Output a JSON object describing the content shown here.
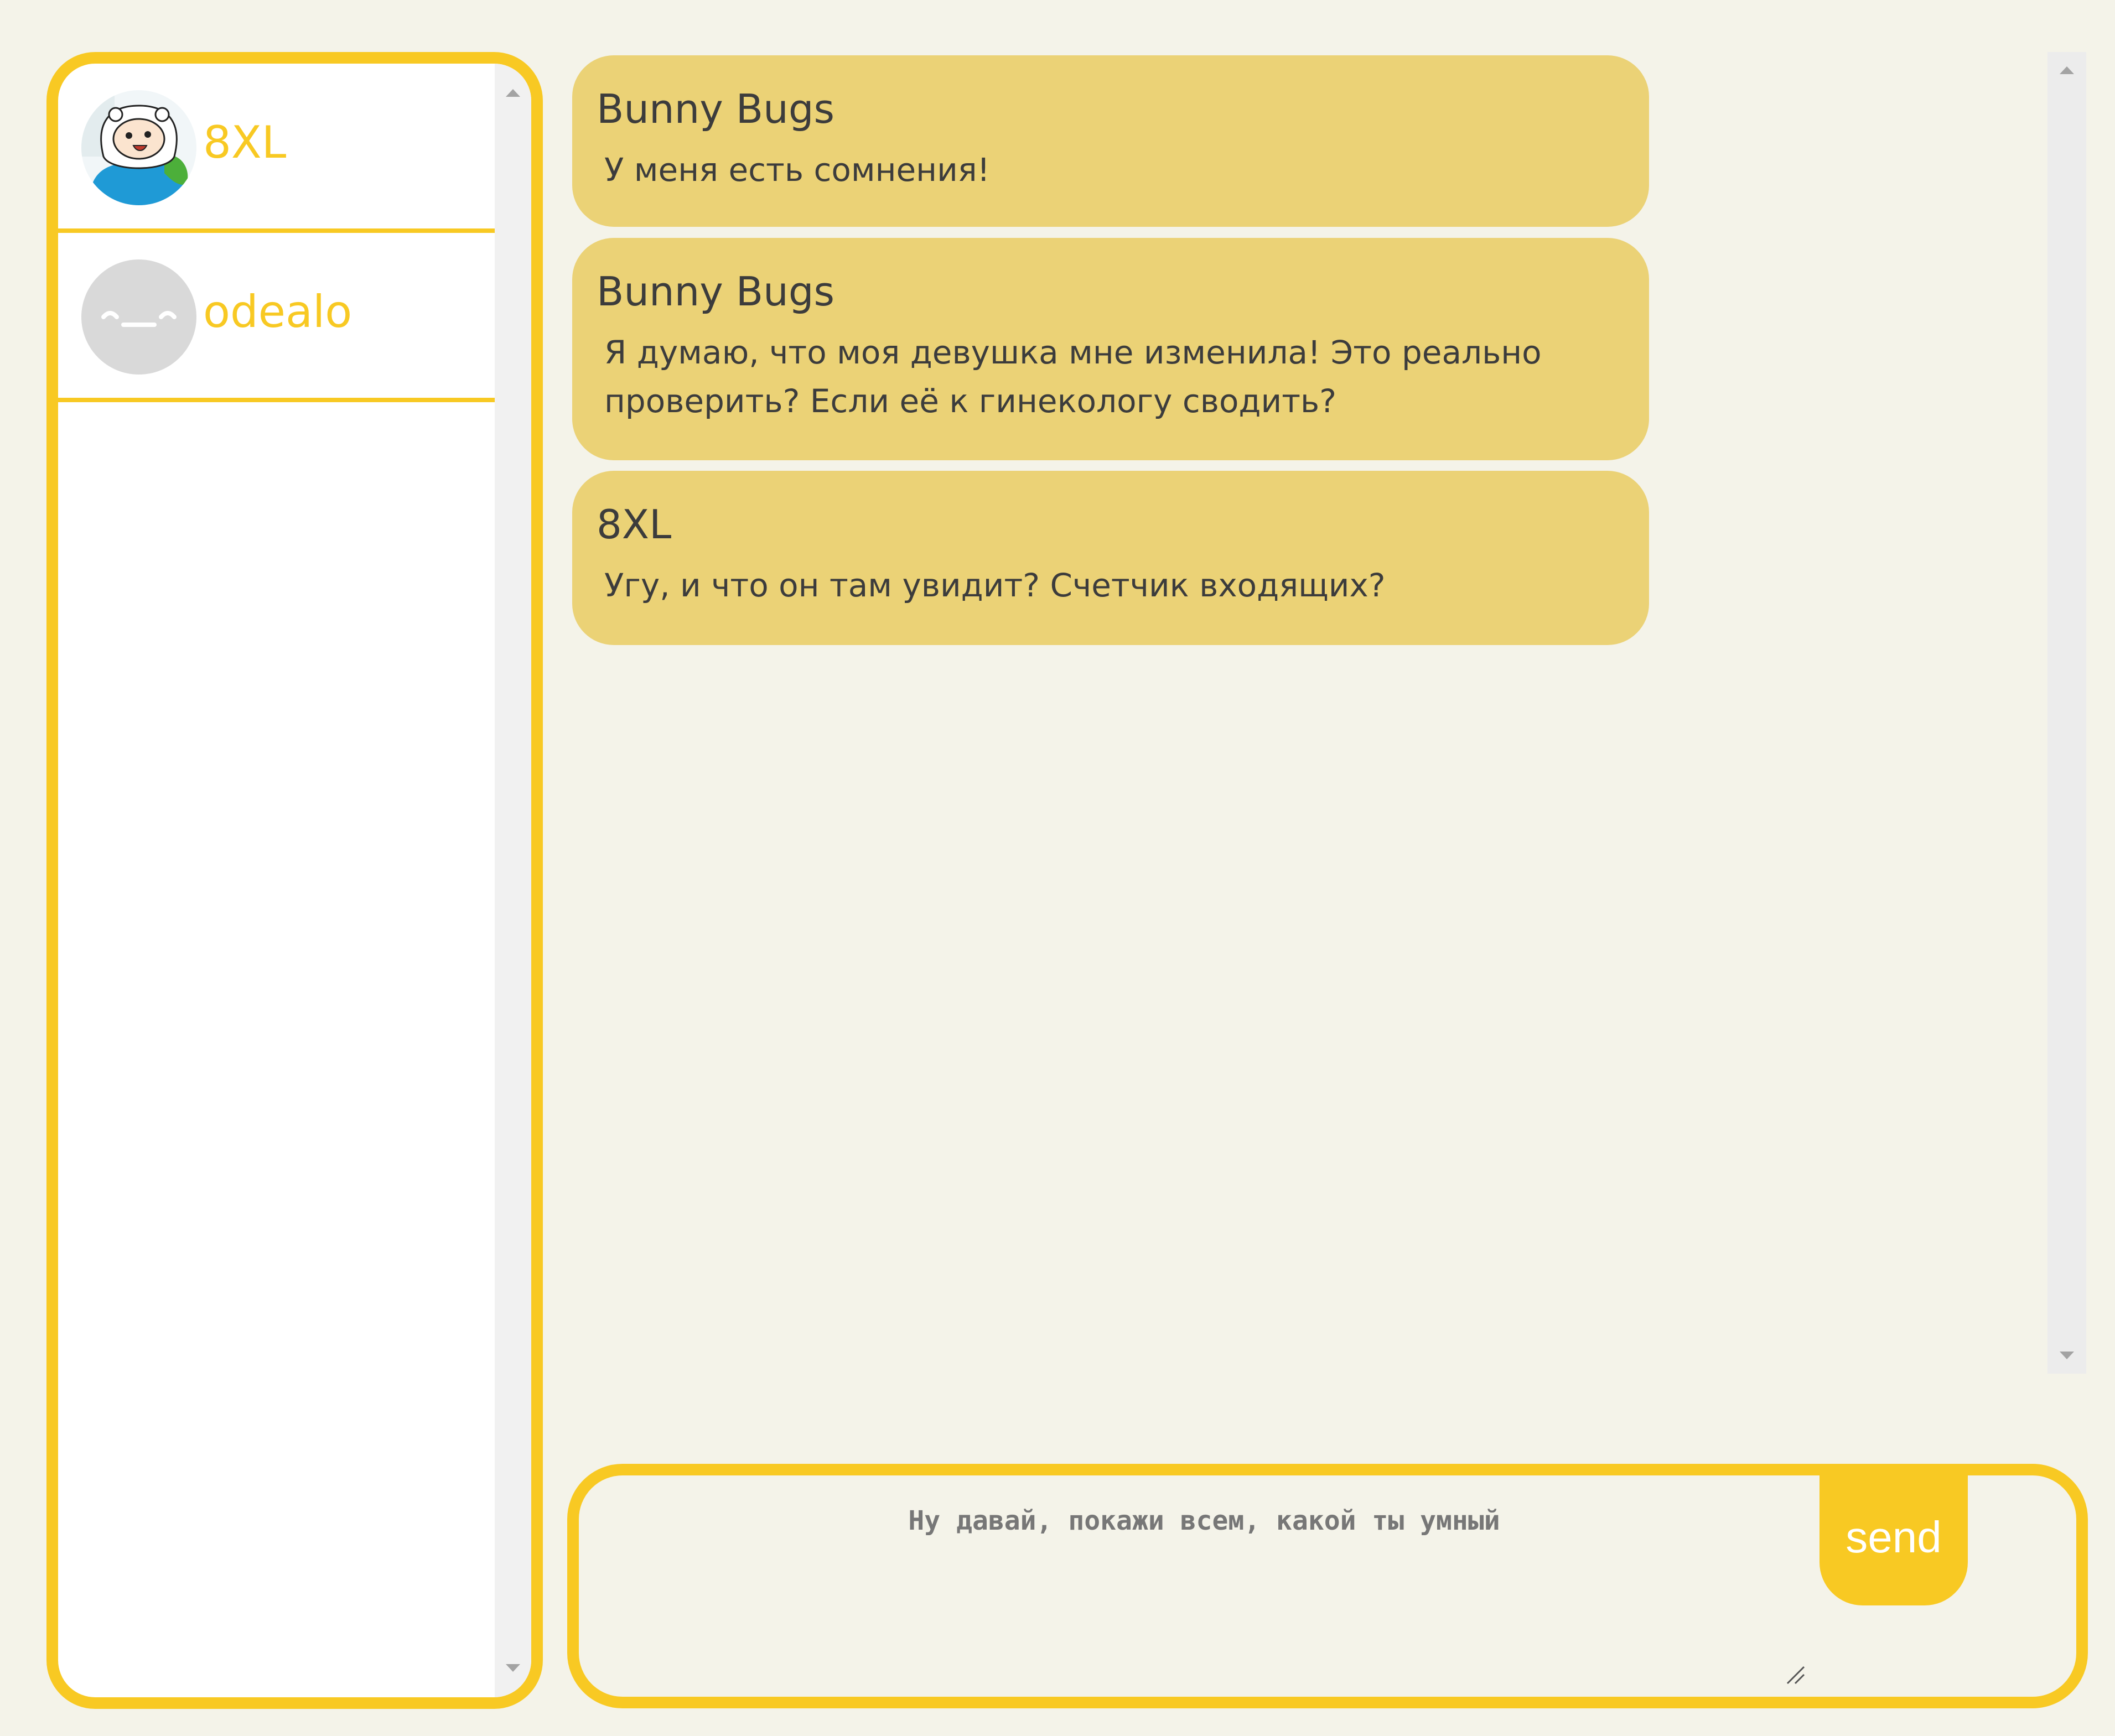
{
  "contacts": [
    {
      "name": "8XL",
      "avatar_icon": "adventure-time-finn-avatar-icon"
    },
    {
      "name": "odealo",
      "avatar_icon": "sleepy-face-avatar-icon"
    }
  ],
  "messages": [
    {
      "author": "Bunny Bugs",
      "text": "У меня есть сомнения!"
    },
    {
      "author": "Bunny Bugs",
      "text": "Я думаю, что моя девушка мне изменила! Это реально проверить? Если её к гинекологу сводить?"
    },
    {
      "author": "8XL",
      "text": "Угу, и что он там увидит? Счетчик входящих?"
    }
  ],
  "composer": {
    "placeholder": "Ну давай, покажи всем, какой ты умный",
    "send_label": "send"
  },
  "colors": {
    "accent": "#f8c923",
    "bubble": "#ebd276",
    "background": "#f4f3e9"
  }
}
